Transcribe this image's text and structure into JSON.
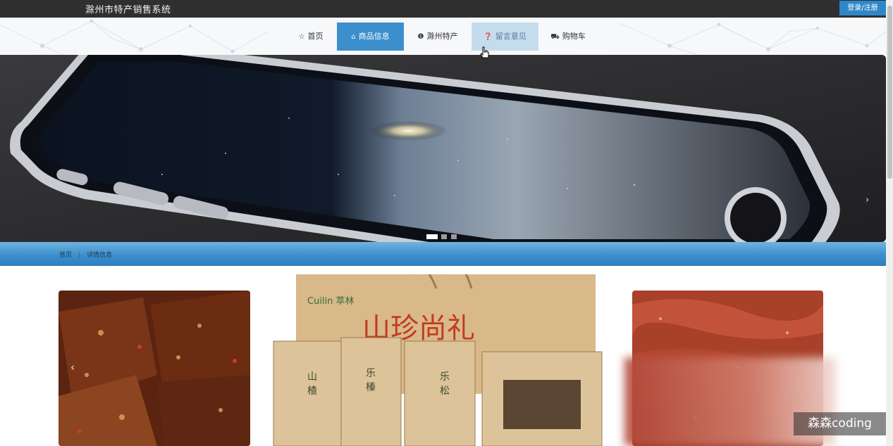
{
  "header": {
    "site_title": "滁州市特产销售系统",
    "login_label": "登录/注册"
  },
  "nav": {
    "items": [
      {
        "label": "首页",
        "icon": "star-icon"
      },
      {
        "label": "商品信息",
        "icon": "bag-icon"
      },
      {
        "label": "滁州特产",
        "icon": "info-icon"
      },
      {
        "label": "留言意见",
        "icon": "question-icon"
      },
      {
        "label": "购物车",
        "icon": "cart-icon"
      }
    ],
    "active_index": 1,
    "hover_index": 3
  },
  "banner": {
    "next_arrow": "›",
    "dot_count": 3,
    "active_dot": 0
  },
  "breadcrumb": {
    "home": "首页",
    "separator": "⋮",
    "current": "详情信息"
  },
  "products": {
    "left_image": "braised-tofu",
    "center_image_text": {
      "brand": "Cuilin 萃林",
      "title": "山珍尚礼"
    },
    "right_image": "spicy-beef-jerky",
    "prev_arrow": "‹"
  },
  "watermark": "森森coding",
  "colors": {
    "topbar": "#2f2f2f",
    "accent": "#3a8fcc",
    "hover": "#c5dced",
    "crumbbar": "#3c8fcb"
  }
}
